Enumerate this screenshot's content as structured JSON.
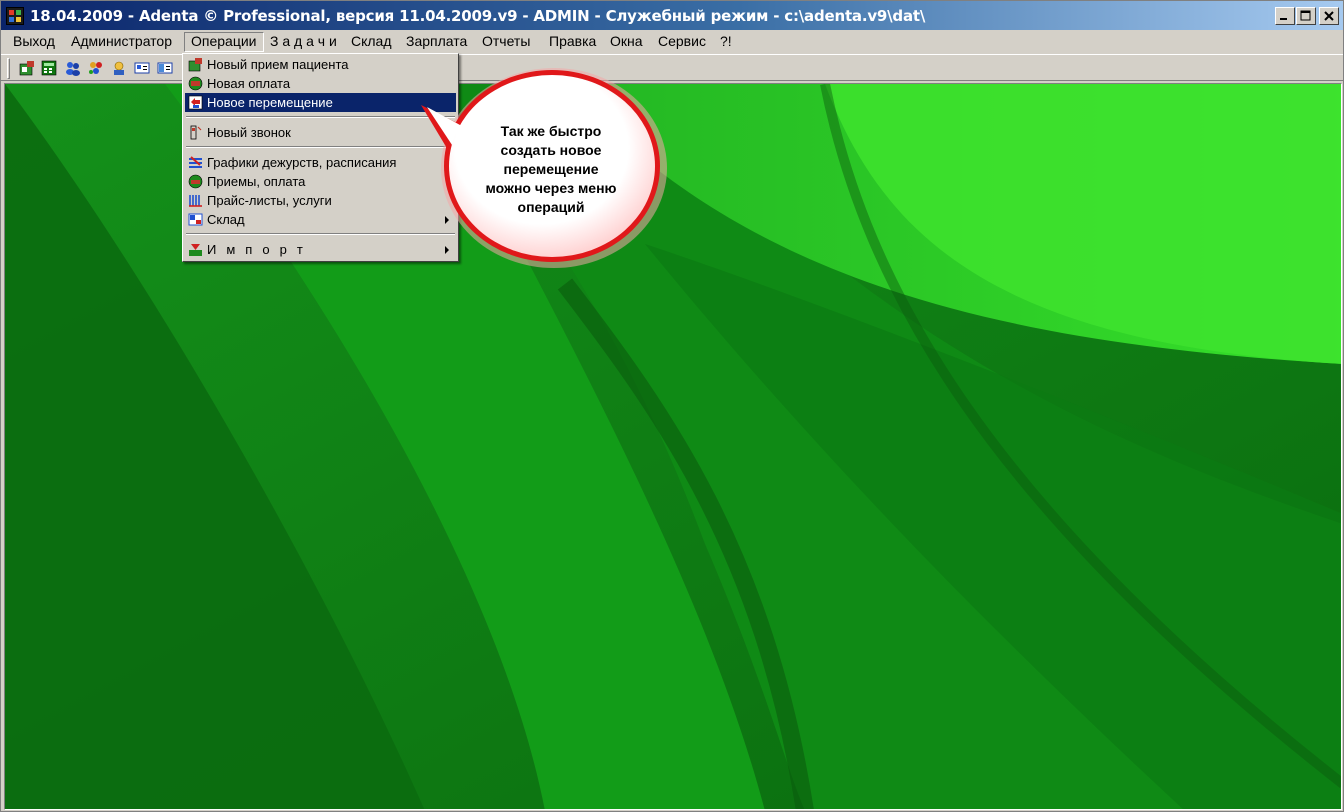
{
  "window": {
    "title": "18.04.2009 - Adenta © Professional, версия 11.04.2009.v9 - ADMIN - Служебный режим - c:\\adenta.v9\\dat\\",
    "controls": {
      "minimize": "_",
      "maximize": "□",
      "close": "X"
    }
  },
  "menubar": {
    "items": [
      {
        "label": "Выход"
      },
      {
        "label": "Администратор"
      },
      {
        "label": "Операции",
        "open": true
      },
      {
        "label": "З а д а ч и"
      },
      {
        "label": "Склад"
      },
      {
        "label": "Зарплата"
      },
      {
        "label": "Отчеты"
      },
      {
        "label": "Правка"
      },
      {
        "label": "Окна"
      },
      {
        "label": "Сервис"
      },
      {
        "label": "?!"
      }
    ]
  },
  "toolbar": {
    "icons": [
      "new-patient-icon",
      "calculator-icon",
      "users-icon",
      "colors-icon",
      "user-icon",
      "card-icon",
      "journal-icon"
    ]
  },
  "operations_menu": {
    "items": [
      {
        "label": "Новый прием пациента",
        "icon": "new-appointment-icon"
      },
      {
        "label": "Новая оплата",
        "icon": "new-payment-icon"
      },
      {
        "label": "Новое перемещение",
        "icon": "new-transfer-icon",
        "selected": true
      },
      {
        "label": "Новый звонок",
        "icon": "new-call-icon"
      },
      {
        "label": "Графики дежурств, расписания",
        "icon": "schedule-icon"
      },
      {
        "label": "Приемы, оплата",
        "icon": "appointments-payment-icon"
      },
      {
        "label": "Прайс-листы, услуги",
        "icon": "price-list-icon"
      },
      {
        "label": "Склад",
        "icon": "warehouse-icon",
        "submenu": true
      },
      {
        "label": "И м п о р т",
        "icon": "import-icon",
        "submenu": true
      }
    ]
  },
  "callout": {
    "text_lines": [
      "Так же быстро",
      "создать новое",
      "перемещение",
      "можно через меню",
      "операций"
    ],
    "border_color": "#e0181a"
  },
  "colors": {
    "selection": "#0a246a",
    "desktop_green": "#1f9e1f"
  }
}
